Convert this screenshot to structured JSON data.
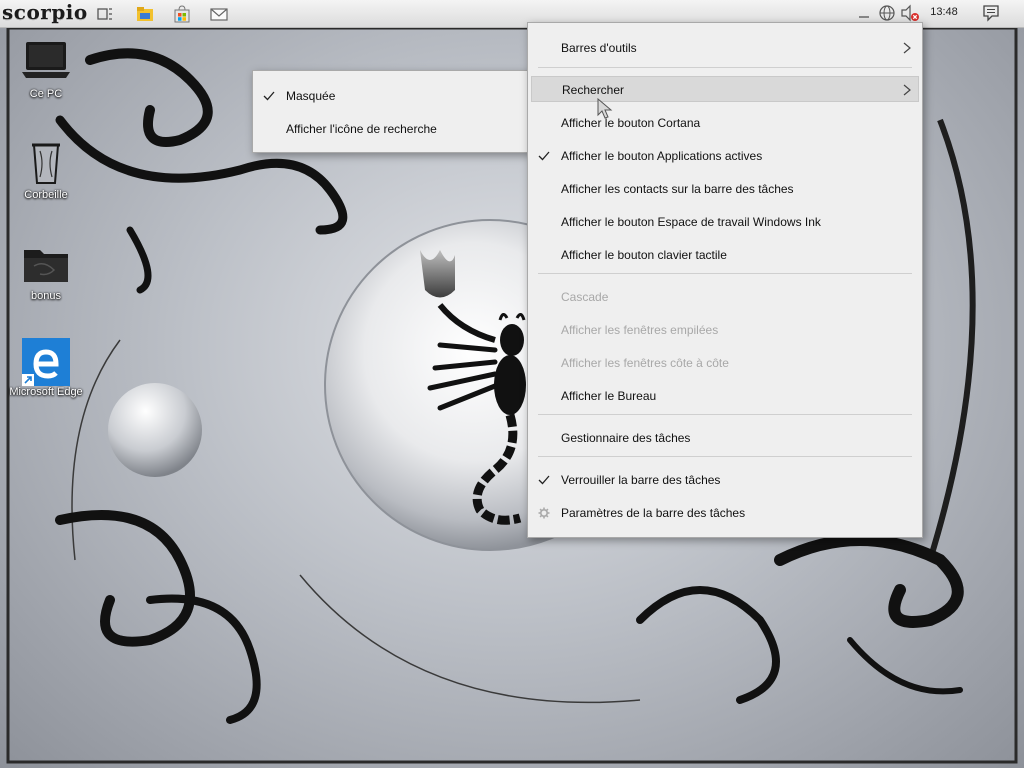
{
  "taskbar": {
    "logo": "scorpio",
    "clock": "13:48",
    "pinned_icons": [
      "task-view-icon",
      "file-explorer-icon",
      "store-icon",
      "mail-icon"
    ],
    "tray_icons": [
      "network-globe-icon",
      "volume-muted-icon",
      "notifications-icon"
    ]
  },
  "desktop": {
    "icons": [
      {
        "label": "Ce PC",
        "icon": "laptop-icon"
      },
      {
        "label": "Corbeille",
        "icon": "recycle-bin-icon"
      },
      {
        "label": "bonus",
        "icon": "folder-icon"
      },
      {
        "label": "Microsoft Edge",
        "icon": "edge-icon"
      }
    ]
  },
  "submenu": {
    "items": [
      {
        "label": "Masquée",
        "checked": true
      },
      {
        "label": "Afficher l'icône de recherche",
        "checked": false
      }
    ]
  },
  "context_menu": {
    "items": [
      {
        "label": "Barres d'outils",
        "submenu": true
      },
      {
        "label": "Rechercher",
        "submenu": true,
        "highlighted": true
      },
      {
        "label": "Afficher le bouton Cortana"
      },
      {
        "label": "Afficher le bouton Applications actives",
        "checked": true
      },
      {
        "label": "Afficher les contacts sur la barre des tâches"
      },
      {
        "label": "Afficher le bouton Espace de travail Windows Ink"
      },
      {
        "label": "Afficher le bouton clavier tactile"
      },
      {
        "label": "Cascade",
        "disabled": true
      },
      {
        "label": "Afficher les fenêtres empilées",
        "disabled": true
      },
      {
        "label": "Afficher les fenêtres côte à côte",
        "disabled": true
      },
      {
        "label": "Afficher le Bureau"
      },
      {
        "label": "Gestionnaire des tâches"
      },
      {
        "label": "Verrouiller la barre des tâches",
        "checked": true
      },
      {
        "label": "Paramètres de la barre des tâches",
        "icon": "gear-icon"
      }
    ]
  },
  "colors": {
    "menu_bg": "#efefef",
    "menu_hover": "#d9d9d9",
    "disabled_text": "#a8a8a8",
    "edge_blue": "#1e7fd6"
  }
}
